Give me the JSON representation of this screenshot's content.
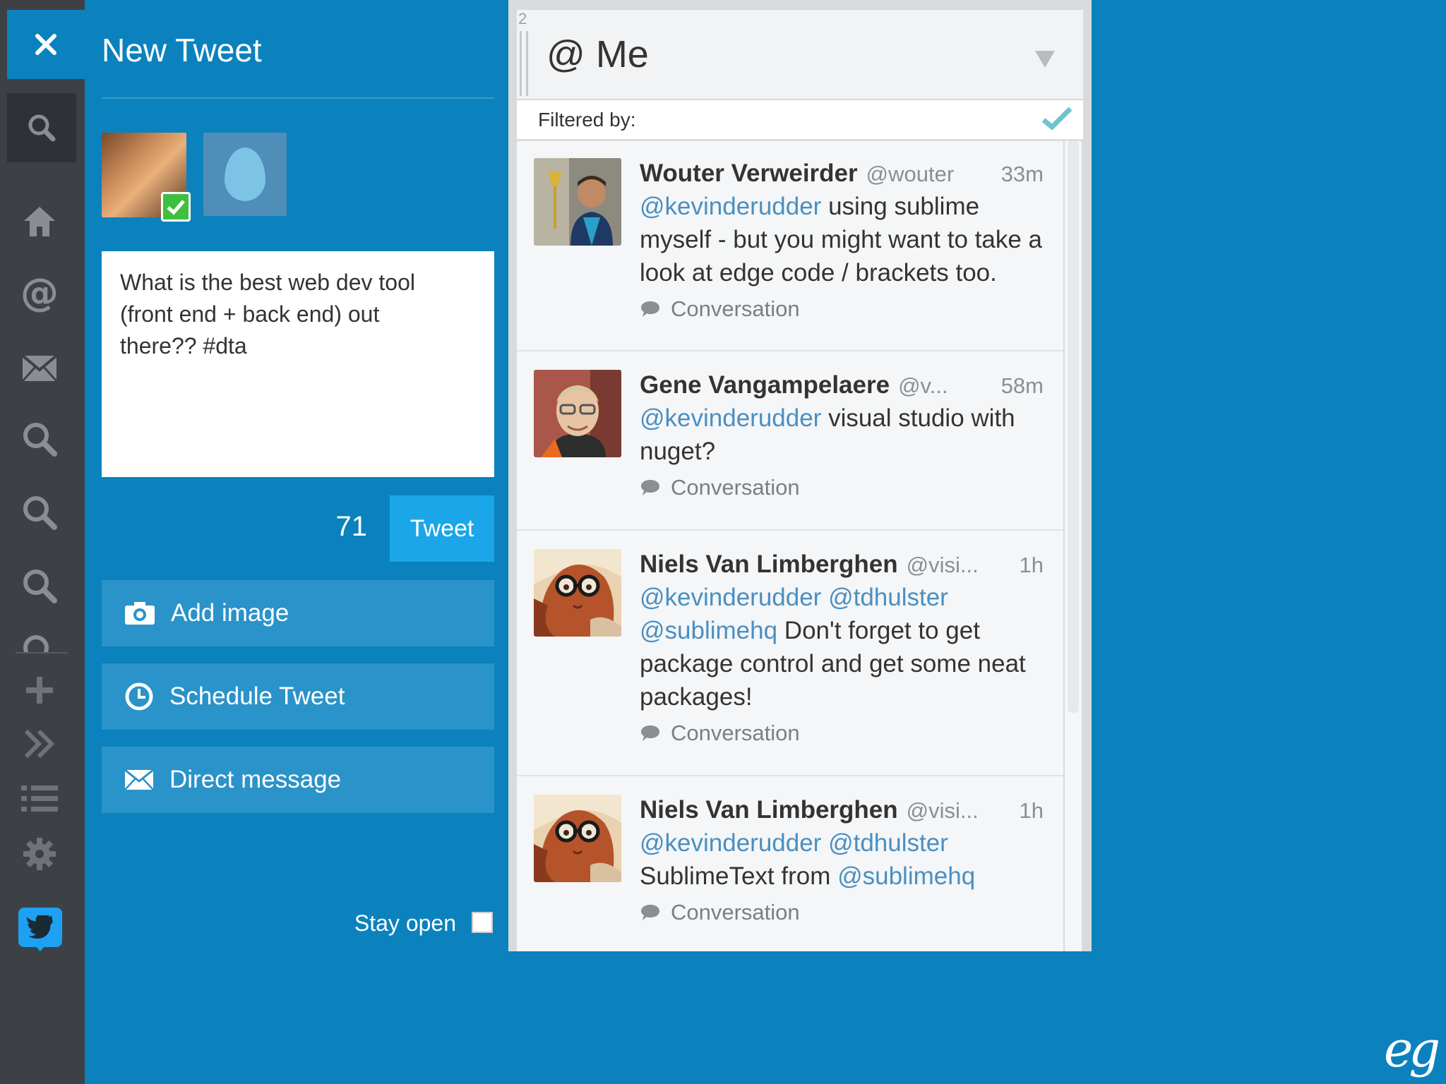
{
  "compose": {
    "title": "New Tweet",
    "tweet_text": "What is the best web dev tool\n(front end + back end) out\nthere?? #dta",
    "char_count": "71",
    "tweet_button": "Tweet",
    "add_image": "Add image",
    "schedule_tweet": "Schedule Tweet",
    "direct_message": "Direct message",
    "stay_open": "Stay open"
  },
  "column": {
    "number": "2",
    "title": "@ Me",
    "filter_label": "Filtered by:",
    "conversation_label": "Conversation",
    "tweets": [
      {
        "name": "Wouter Verweirder",
        "handle": "@wouter",
        "time": "33m",
        "mention": "@kevinderudder",
        "text": " using sublime myself - but you might want to take a look at edge code / brackets too."
      },
      {
        "name": "Gene Vangampelaere",
        "handle": "@v...",
        "time": "58m",
        "mention": "@kevinderudder",
        "text": " visual studio with nuget?"
      },
      {
        "name": "Niels Van Limberghen",
        "handle": "@visi...",
        "time": "1h",
        "mention": "@kevinderudder @tdhulster",
        "mention2": "@sublimehq",
        "text": " Don't forget to get package control and get some neat packages!"
      },
      {
        "name": "Niels Van Limberghen",
        "handle": "@visi...",
        "time": "1h",
        "mention": "@kevinderudder @tdhulster",
        "text_pre": "SublimeText from ",
        "mention2": "@sublimehq"
      }
    ]
  },
  "watermark": "eg",
  "colors": {
    "background": "#0b82bd",
    "rail": "#3d4145",
    "tweet_button": "#1aa6e8",
    "action_button": "#2a93c9",
    "mention": "#4a8fc2"
  }
}
